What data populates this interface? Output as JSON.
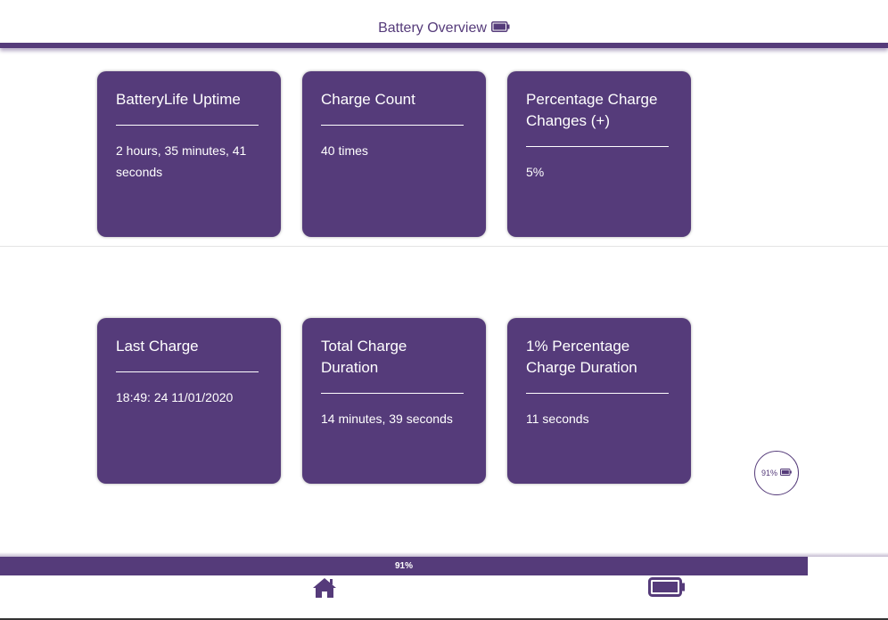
{
  "header": {
    "title": "Battery Overview",
    "icon": "battery-icon"
  },
  "cards": [
    {
      "title": "BatteryLife Uptime",
      "value": "2 hours, 35 minutes, 41 seconds"
    },
    {
      "title": "Charge Count",
      "value": "40 times"
    },
    {
      "title": "Percentage Charge Changes (+)",
      "value": "5%"
    },
    {
      "title": "Last Charge",
      "value": "18:49: 24 11/01/2020"
    },
    {
      "title": "Total Charge Duration",
      "value": "14 minutes, 39 seconds"
    },
    {
      "title": "1% Percentage Charge Duration",
      "value": "11 seconds"
    }
  ],
  "badge": {
    "label": "91%",
    "icon": "battery-icon"
  },
  "progress": {
    "label": "91%",
    "value": 0.91
  },
  "nav": {
    "home_icon": "home-icon",
    "battery_icon": "battery-icon"
  },
  "colors": {
    "accent": "#553b7a",
    "card_background": "#553b7a",
    "text_on_accent": "#ffffff",
    "background": "#ffffff"
  }
}
